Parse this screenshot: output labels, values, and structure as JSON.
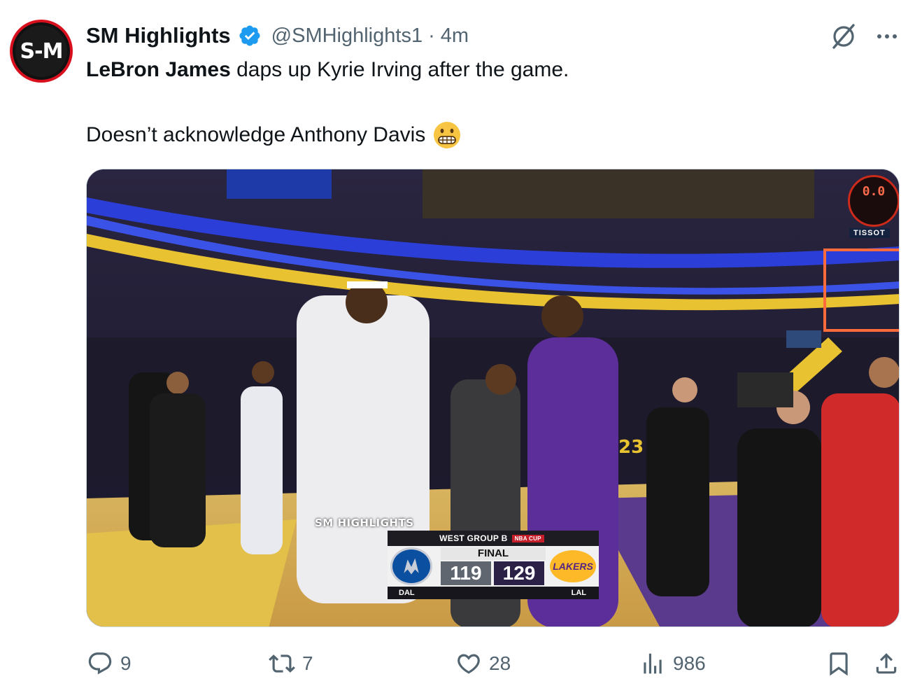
{
  "tweet": {
    "author": {
      "display_name": "SM Highlights",
      "handle": "@SMHighlights1",
      "verified": true,
      "avatar_text": "S-M"
    },
    "separator": "·",
    "timestamp": "4m",
    "text_line1_bold": "LeBron James",
    "text_line1_rest": " daps up Kyrie Irving after the game.",
    "text_line2": "Doesn’t acknowledge Anthony Davis",
    "emoji": "grimacing-face",
    "media": {
      "watermark": "SM HIGHLIGHTS",
      "shot_clock": "0.0",
      "clock_brand": "TISSOT",
      "scorebug": {
        "group": "WEST GROUP B",
        "cup": "NBA CUP",
        "status": "FINAL",
        "away_abbr": "DAL",
        "away_score": "119",
        "home_score": "129",
        "home_abbr": "LAL",
        "home_logo_text": "LAKERS"
      }
    },
    "actions": {
      "replies": "9",
      "reposts": "7",
      "likes": "28",
      "views": "986"
    }
  },
  "colors": {
    "text_primary": "#0f1419",
    "text_secondary": "#536471",
    "verified_blue": "#1d9bf0",
    "lakers_purple": "#552583",
    "lakers_gold": "#fdb927",
    "mavs_blue": "#0b4fa0"
  },
  "icons": {
    "verified": "verified-badge-icon",
    "grok": "grok-icon",
    "more": "more-icon",
    "reply": "reply-icon",
    "repost": "repost-icon",
    "like": "heart-icon",
    "views": "views-icon",
    "bookmark": "bookmark-icon",
    "share": "share-icon"
  }
}
